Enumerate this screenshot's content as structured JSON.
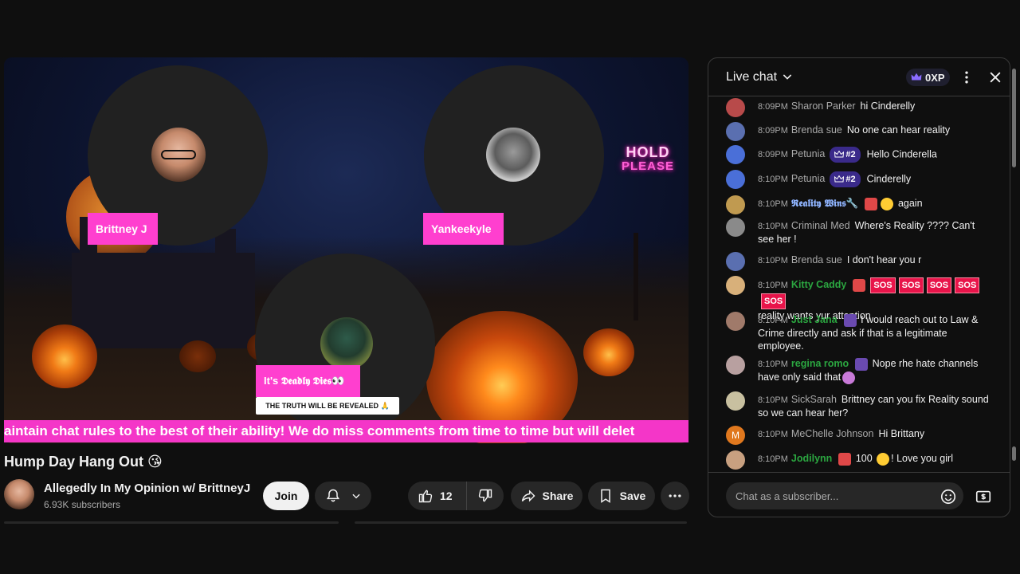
{
  "video": {
    "hold_line1": "HOLD",
    "hold_line2": "PLEASE",
    "participants": [
      {
        "name": "Brittney J"
      },
      {
        "name": "Yankeekyle"
      },
      {
        "name": "It's 𝕯𝖊𝖆𝖉𝖑𝖞 𝕯𝖎𝖊𝖘👀"
      }
    ],
    "subtag": "THE TRUTH WILL BE REVEALED 🙏",
    "ticker": "aintain chat rules to the best of their ability! We do miss comments from time to time but will delet"
  },
  "meta": {
    "title": "Hump Day Hang Out 😘",
    "channel_name": "Allegedly In My Opinion w/ BrittneyJ",
    "subscribers": "6.93K subscribers",
    "join_label": "Join",
    "like_count": "12",
    "share_label": "Share",
    "save_label": "Save"
  },
  "chat": {
    "title": "Live chat",
    "xp": "0XP",
    "input_placeholder": "Chat as a subscriber...",
    "messages": [
      {
        "time": "8:09PM",
        "author": "Sharon Parker",
        "text": "hi Cinderelly",
        "avatar_color": "#b84a4a"
      },
      {
        "time": "8:09PM",
        "author": "Brenda sue",
        "text": "No one can hear reality",
        "avatar_color": "#5a6fb0"
      },
      {
        "time": "8:09PM",
        "author": "Petunia",
        "rank": "#2",
        "text": "Hello Cinderella",
        "avatar_color": "#4a6fd8"
      },
      {
        "time": "8:10PM",
        "author": "Petunia",
        "rank": "#2",
        "text": "Cinderelly",
        "avatar_color": "#4a6fd8"
      },
      {
        "time": "8:10PM",
        "author": "𝕽𝖊𝖆𝖑𝖎𝖙𝖞 𝖂𝖎𝖓𝖘🔧",
        "text": "again",
        "avatar_color": "#c09a50"
      },
      {
        "time": "8:10PM",
        "author": "Criminal Med",
        "text": "Where's Reality ???? Can't see her !",
        "avatar_color": "#8a8a8a"
      },
      {
        "time": "8:10PM",
        "author": "Brenda sue",
        "text": "I don't hear you r",
        "avatar_color": "#5a6fb0"
      },
      {
        "time": "8:10PM",
        "author": "Kitty Caddy",
        "text": "reality wants yur attention",
        "sos": "SOS",
        "avatar_color": "#d8b07a"
      },
      {
        "time": "8:10PM",
        "author": "Just Jana",
        "text": "I would reach out to Law & Crime directly and ask if that is a legitimate employee.",
        "avatar_color": "#a07a6a"
      },
      {
        "time": "8:10PM",
        "author": "regina romo",
        "text": "Nope rhe hate channels have only said that",
        "avatar_color": "#b8a0a0"
      },
      {
        "time": "8:10PM",
        "author": "SickSarah",
        "text": "Brittney can you fix Reality sound so we can hear her?",
        "avatar_color": "#c8c0a0"
      },
      {
        "time": "8:10PM",
        "author": "MeChelle Johnson",
        "text": "Hi Brittany",
        "initial": "M",
        "avatar_color": "#e0781e"
      },
      {
        "time": "8:10PM",
        "author": "Jodilynn",
        "text": "100",
        "text2": "! Love you girl",
        "avatar_color": "#c8a080"
      }
    ]
  },
  "colors": {
    "accent_pink": "#ff3fcf",
    "ticker_pink": "#f436c8",
    "green_member": "#2ba640",
    "rank_purple": "#3a2a8a"
  }
}
